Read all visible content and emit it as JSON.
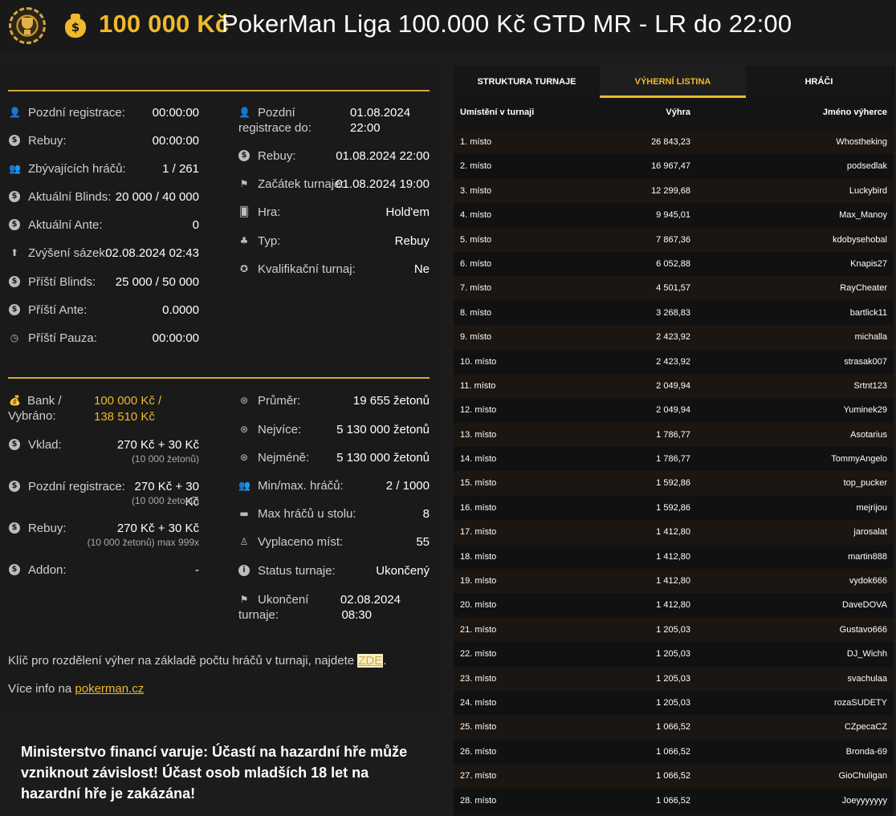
{
  "header": {
    "prize": "100 000 Kč",
    "title": "PokerMan Liga 100.000 Kč GTD MR - LR do 22:00"
  },
  "info_left": [
    {
      "label": "Pozdní registrace:",
      "value": "00:00:00",
      "icon": "user-icon"
    },
    {
      "label": "Rebuy:",
      "value": "00:00:00",
      "icon": "coins-icon"
    },
    {
      "label": "Zbývajících hráčů:",
      "value": "1 / 261",
      "icon": "users-icon"
    },
    {
      "label": "Aktuální Blinds:",
      "value": "20 000 / 40 000",
      "icon": "coins-icon"
    },
    {
      "label": "Aktuální Ante:",
      "value": "0",
      "icon": "dollar-coin-icon"
    },
    {
      "label": "Zvýšení sázek:",
      "value": "02.08.2024 02:43",
      "icon": "arrow-up-circle-icon"
    },
    {
      "label": "Příští Blinds:",
      "value": "25 000 / 50 000",
      "icon": "coins-icon"
    },
    {
      "label": "Příští Ante:",
      "value": "0.0000",
      "icon": "dollar-coin-icon"
    },
    {
      "label": "Příští Pauza:",
      "value": "00:00:00",
      "icon": "clock-icon"
    }
  ],
  "info_right": [
    {
      "label": "Pozdní registrace do:",
      "value": "01.08.2024 22:00",
      "icon": "user-icon"
    },
    {
      "label": "Rebuy:",
      "value": "01.08.2024 22:00",
      "icon": "coins-icon"
    },
    {
      "label": "Začátek turnaje:",
      "value": "01.08.2024 19:00",
      "icon": "flag-icon"
    },
    {
      "label": "Hra:",
      "value": "Hold'em",
      "icon": "cards-icon"
    },
    {
      "label": "Typ:",
      "value": "Rebuy",
      "icon": "suits-icon"
    },
    {
      "label": "Kvalifikační turnaj:",
      "value": "Ne",
      "icon": "medal-icon"
    }
  ],
  "finance_left": {
    "bank_label": "Bank / Vybráno:",
    "bank_value_1": "100 000 Kč /",
    "bank_value_2": "138 510 Kč",
    "vklad_label": "Vklad:",
    "vklad_value": "270 Kč + 30 Kč",
    "vklad_sub": "(10 000 žetonů)",
    "late_label": "Pozdní registrace:",
    "late_value": "270 Kč + 30 Kč",
    "late_sub": "(10 000 žetonů)",
    "rebuy_label": "Rebuy:",
    "rebuy_value": "270 Kč + 30 Kč",
    "rebuy_sub": "(10 000 žetonů) max 999x",
    "addon_label": "Addon:",
    "addon_value": "-"
  },
  "finance_right": [
    {
      "label": "Průměr:",
      "value": "19 655 žetonů",
      "icon": "chip-icon"
    },
    {
      "label": "Nejvíce:",
      "value": "5 130 000 žetonů",
      "icon": "chip-icon"
    },
    {
      "label": "Nejméně:",
      "value": "5 130 000 žetonů",
      "icon": "chip-icon"
    },
    {
      "label": "Min/max. hráčů:",
      "value": "2 / 1000",
      "icon": "users-icon"
    },
    {
      "label": "Max hráčů u stolu:",
      "value": "8",
      "icon": "table-icon"
    },
    {
      "label": "Vyplaceno míst:",
      "value": "55",
      "icon": "award-icon"
    },
    {
      "label": "Status turnaje:",
      "value": "Ukončený",
      "icon": "info-icon"
    }
  ],
  "end": {
    "label_1": "Ukončení",
    "label_2": "turnaje:",
    "value_1": "02.08.2024",
    "value_2": "08:30"
  },
  "notes": {
    "key_text": "Klíč pro rozdělení výher na základě počtu hráčů v turnaji, najdete ",
    "key_link": "ZDE",
    "key_end": ".",
    "more_text": "Více info na ",
    "more_link": "pokerman.cz"
  },
  "warning": "Ministerstvo financí varuje: Účastí na hazardní hře může vzniknout závislost! Účast osob mladších 18 let na hazardní hře je zakázána!",
  "tabs": [
    "STRUKTURA TURNAJE",
    "VÝHERNÍ LISTINA",
    "HRÁČI"
  ],
  "table": {
    "headers": [
      "Umístění v turnaji",
      "Výhra",
      "Jméno výherce"
    ],
    "rows": [
      [
        "1. místo",
        "26 843,23",
        "Whostheking"
      ],
      [
        "2. místo",
        "16 967,47",
        "podsedlak"
      ],
      [
        "3. místo",
        "12 299,68",
        "Luckybird"
      ],
      [
        "4. místo",
        "9 945,01",
        "Max_Manoy"
      ],
      [
        "5. místo",
        "7 867,36",
        "kdobysehobal"
      ],
      [
        "6. místo",
        "6 052,88",
        "Knapis27"
      ],
      [
        "7. místo",
        "4 501,57",
        "RayCheater"
      ],
      [
        "8. místo",
        "3 268,83",
        "bartlick11"
      ],
      [
        "9. místo",
        "2 423,92",
        "michalla"
      ],
      [
        "10. místo",
        "2 423,92",
        "strasak007"
      ],
      [
        "11. místo",
        "2 049,94",
        "Srtnt123"
      ],
      [
        "12. místo",
        "2 049,94",
        "Yuminek29"
      ],
      [
        "13. místo",
        "1 786,77",
        "Asotarius"
      ],
      [
        "14. místo",
        "1 786,77",
        "TommyAngelo"
      ],
      [
        "15. místo",
        "1 592,86",
        "top_pucker"
      ],
      [
        "16. místo",
        "1 592,86",
        "mejrijou"
      ],
      [
        "17. místo",
        "1 412,80",
        "jarosalat"
      ],
      [
        "18. místo",
        "1 412,80",
        "martin888"
      ],
      [
        "19. místo",
        "1 412,80",
        "vydok666"
      ],
      [
        "20. místo",
        "1 412,80",
        "DaveDOVA"
      ],
      [
        "21. místo",
        "1 205,03",
        "Gustavo666"
      ],
      [
        "22. místo",
        "1 205,03",
        "DJ_Wichh"
      ],
      [
        "23. místo",
        "1 205,03",
        "svachulaa"
      ],
      [
        "24. místo",
        "1 205,03",
        "rozaSUDETY"
      ],
      [
        "25. místo",
        "1 066,52",
        "CZpecaCZ"
      ],
      [
        "26. místo",
        "1 066,52",
        "Bronda-69"
      ],
      [
        "27. místo",
        "1 066,52",
        "GioChuligan"
      ],
      [
        "28. místo",
        "1 066,52",
        "Joeyyyyyyy"
      ]
    ]
  }
}
